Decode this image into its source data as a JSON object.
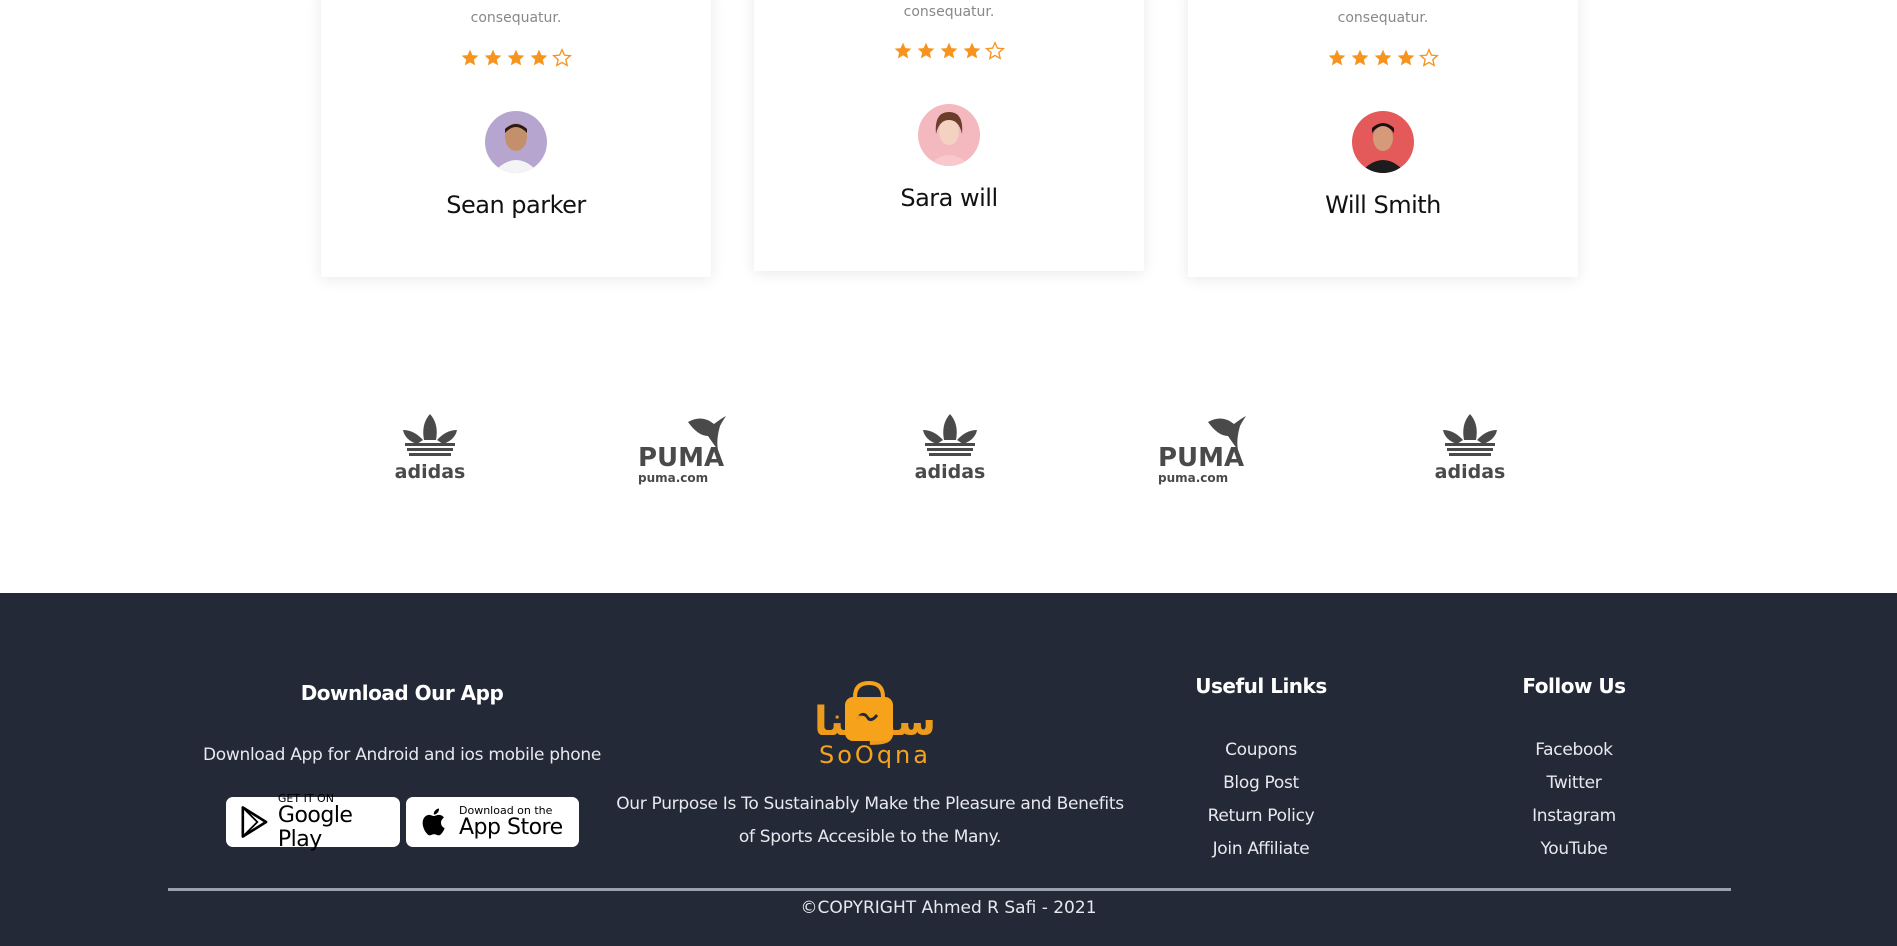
{
  "testimonials": [
    {
      "quote_tail": "consequatur.",
      "rating": 4,
      "rating_max": 5,
      "name": "Sean parker",
      "avatar": "man-white-shirt-avatar"
    },
    {
      "quote_tail": "consequatur.",
      "rating": 4,
      "rating_max": 5,
      "name": "Sara will",
      "avatar": "woman-pink-avatar"
    },
    {
      "quote_tail": "consequatur.",
      "rating": 4,
      "rating_max": 5,
      "name": "Will Smith",
      "avatar": "man-black-shirt-avatar"
    }
  ],
  "brands": [
    {
      "name": "adidas",
      "label": "adidas"
    },
    {
      "name": "puma",
      "label": "PUMA",
      "sub": "puma.com"
    },
    {
      "name": "adidas",
      "label": "adidas"
    },
    {
      "name": "puma",
      "label": "PUMA",
      "sub": "puma.com"
    },
    {
      "name": "adidas",
      "label": "adidas"
    }
  ],
  "footer": {
    "download": {
      "title": "Download Our App",
      "text": "Download App for Android and ios mobile phone",
      "google_small": "GET IT ON",
      "google_big": "Google Play",
      "apple_small": "Download on the",
      "apple_big": "App Store"
    },
    "about": {
      "logo_arabic": "سوقنا",
      "logo_latin": "SoOqna",
      "text_line1": "Our Purpose Is To Sustainably Make the Pleasure and Benefits",
      "text_line2": "of Sports Accesible to the Many."
    },
    "useful_links": {
      "title": "Useful Links",
      "items": [
        "Coupons",
        "Blog Post",
        "Return Policy",
        "Join Affiliate"
      ]
    },
    "follow_us": {
      "title": "Follow Us",
      "items": [
        "Facebook",
        "Twitter",
        "Instagram",
        "YouTube"
      ]
    },
    "copyright": "©COPYRIGHT Ahmed R Safi - 2021"
  },
  "colors": {
    "star": "#f7941d",
    "footer_bg": "#232937",
    "logo_orange": "#f7a21b",
    "brand_gray": "#4a4a4a"
  }
}
